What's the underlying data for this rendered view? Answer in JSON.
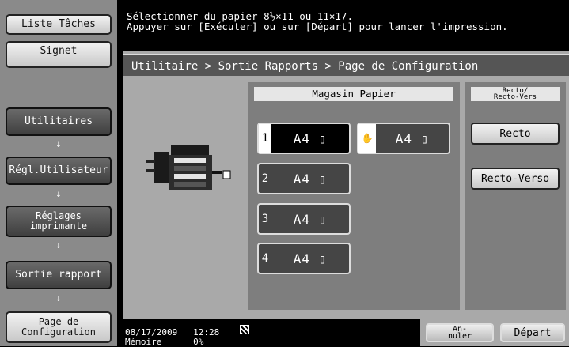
{
  "sidebar": {
    "list_tasks": "Liste Tâches",
    "bookmark": "Signet",
    "utilities": "Utilitaires",
    "user_settings": "Régl.Utilisateur",
    "printer_settings": "Réglages imprimante",
    "output_report": "Sortie rapport",
    "config_page": "Page de Configuration",
    "arrow": "↓"
  },
  "message": {
    "line1": "Sélectionner du papier 8½×11 ou 11×17.",
    "line2": "Appuyer sur [Exécuter] ou sur [Départ] pour lancer l'impression."
  },
  "breadcrumb": "Utilitaire > Sortie Rapports > Page de Configuration",
  "trays": {
    "heading": "Magasin Papier",
    "items": [
      {
        "num": "1",
        "label": "A4 ▯"
      },
      {
        "num": "✋",
        "label": "A4 ▯"
      },
      {
        "num": "2",
        "label": "A4 ▯"
      },
      {
        "num": "3",
        "label": "A4 ▯"
      },
      {
        "num": "4",
        "label": "A4 ▯"
      }
    ]
  },
  "duplex": {
    "heading_line1": "Recto/",
    "heading_line2": "Recto-Vers",
    "simplex": "Recto",
    "duplex": "Recto-Verso"
  },
  "status": {
    "date": "08/17/2009",
    "time": "12:28",
    "memory_label": "Mémoire",
    "memory_value": "0%",
    "cancel": "An-nuler",
    "start": "Départ"
  }
}
